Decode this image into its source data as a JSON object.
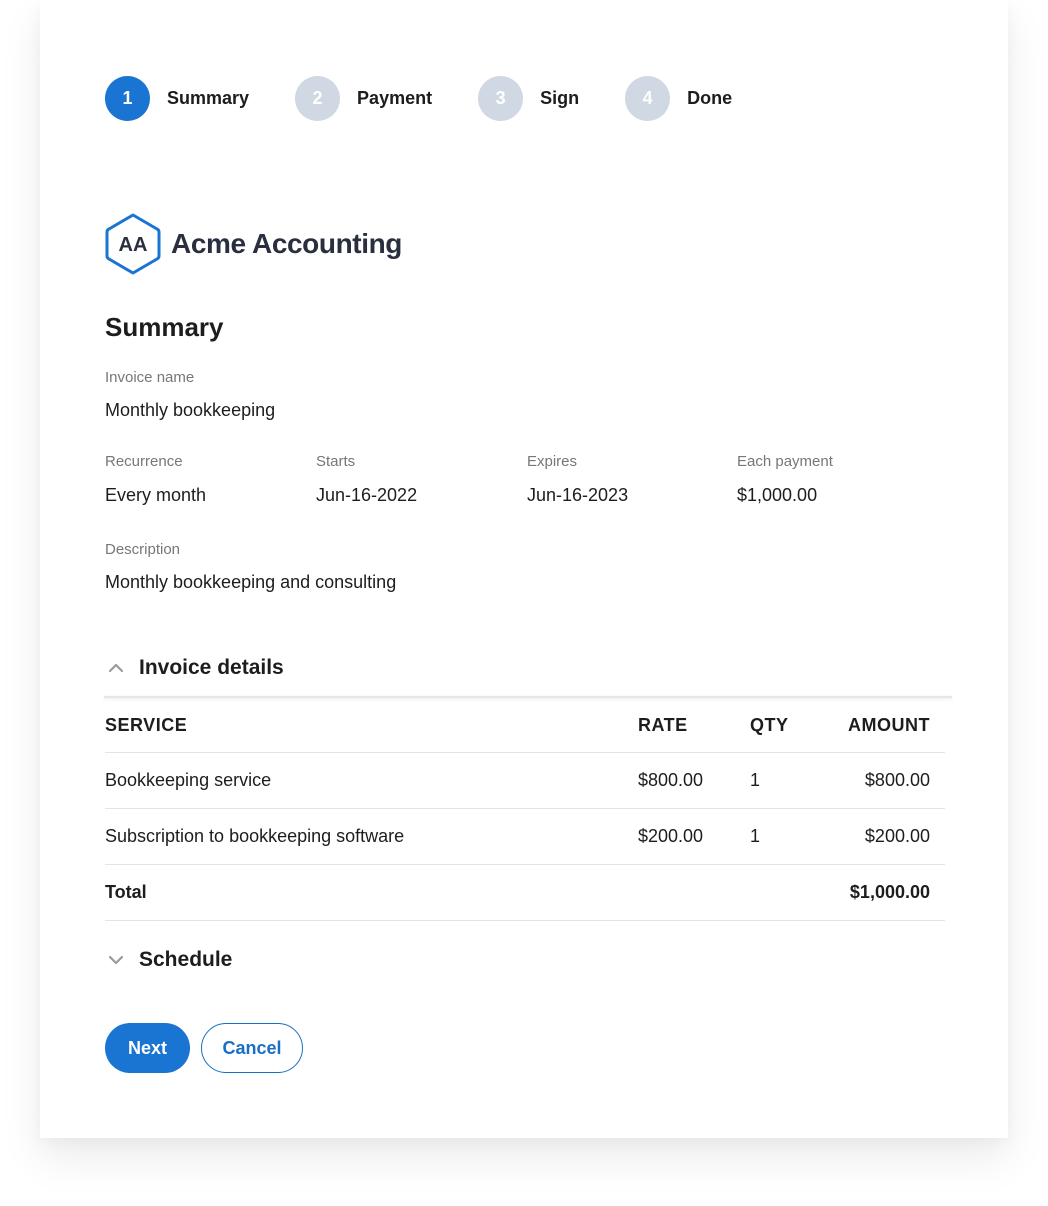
{
  "colors": {
    "accent": "#1a74d2",
    "step_inactive": "#cfd8e3",
    "logo_border": "#1a74d2",
    "label_gray": "#777777"
  },
  "stepper": {
    "steps": [
      {
        "number": "1",
        "label": "Summary",
        "state": "active"
      },
      {
        "number": "2",
        "label": "Payment",
        "state": "inactive"
      },
      {
        "number": "3",
        "label": "Sign",
        "state": "inactive"
      },
      {
        "number": "4",
        "label": "Done",
        "state": "inactive"
      }
    ]
  },
  "brand": {
    "logo_initials": "AA",
    "logo_icon": "hexagon-logo-icon",
    "name": "Acme Accounting"
  },
  "summary": {
    "title": "Summary",
    "invoice_name": {
      "label": "Invoice name",
      "value": "Monthly bookkeeping"
    },
    "recurrence": {
      "label": "Recurrence",
      "value": "Every month"
    },
    "starts": {
      "label": "Starts",
      "value": "Jun-16-2022"
    },
    "expires": {
      "label": "Expires",
      "value": "Jun-16-2023"
    },
    "each_payment": {
      "label": "Each payment",
      "value": "$1,000.00"
    },
    "description": {
      "label": "Description",
      "value": "Monthly bookkeeping and consulting"
    }
  },
  "invoice_details": {
    "title": "Invoice details",
    "expanded": true,
    "icon": "chevron-up-icon",
    "columns": {
      "service": "SERVICE",
      "rate": "RATE",
      "qty": "QTY",
      "amount": "AMOUNT"
    },
    "rows": [
      {
        "service": "Bookkeeping service",
        "rate": "$800.00",
        "qty": "1",
        "amount": "$800.00"
      },
      {
        "service": "Subscription to bookkeeping software",
        "rate": "$200.00",
        "qty": "1",
        "amount": "$200.00"
      }
    ],
    "total": {
      "label": "Total",
      "amount": "$1,000.00"
    }
  },
  "schedule": {
    "title": "Schedule",
    "expanded": false,
    "icon": "chevron-down-icon"
  },
  "actions": {
    "next_label": "Next",
    "cancel_label": "Cancel"
  }
}
